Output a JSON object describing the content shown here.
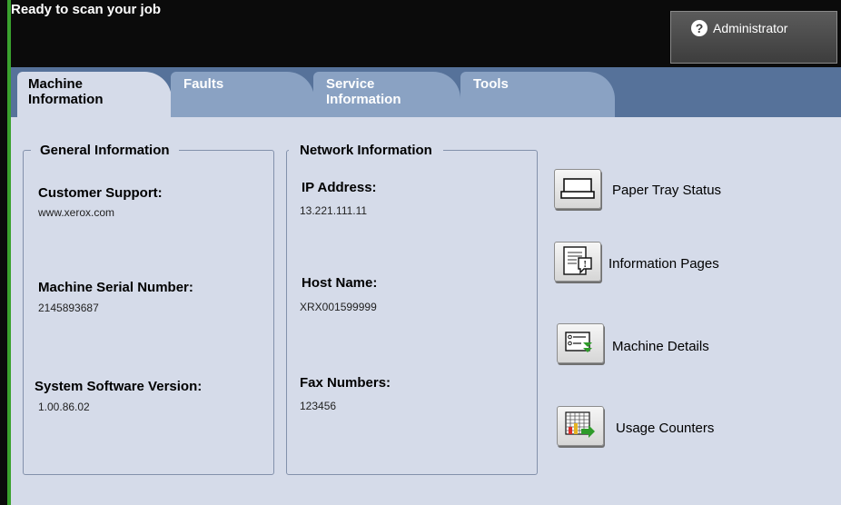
{
  "header": {
    "status": "Ready to scan your job",
    "admin_button": {
      "label": "Administrator",
      "icon": "help-icon"
    }
  },
  "tabs": [
    {
      "label": "Machine Information",
      "active": true
    },
    {
      "label": "Faults",
      "active": false
    },
    {
      "label": "Service Information",
      "active": false
    },
    {
      "label": "Tools",
      "active": false
    }
  ],
  "general": {
    "title": "General Information",
    "customer_support_label": "Customer Support:",
    "customer_support_value": "www.xerox.com",
    "serial_label": "Machine Serial Number:",
    "serial_value": "2145893687",
    "software_label": "System Software Version:",
    "software_value": "1.00.86.02"
  },
  "network": {
    "title": "Network Information",
    "ip_label": "IP Address:",
    "ip_value": "13.221.111.11",
    "host_label": "Host Name:",
    "host_value": "XRX001599999",
    "fax_label": "Fax Numbers:",
    "fax_value": "123456"
  },
  "actions": [
    {
      "label": "Paper Tray Status",
      "icon": "paper-tray-icon"
    },
    {
      "label": "Information Pages",
      "icon": "information-pages-icon"
    },
    {
      "label": "Machine Details",
      "icon": "machine-details-icon"
    },
    {
      "label": "Usage Counters",
      "icon": "usage-counters-icon"
    }
  ],
  "colors": {
    "header_bg": "#0b0b0b",
    "tab_bar": "#56729a",
    "tab_inactive": "#8aa2c3",
    "content_bg": "#d5dbe9",
    "accent_green": "#3aa12e"
  }
}
